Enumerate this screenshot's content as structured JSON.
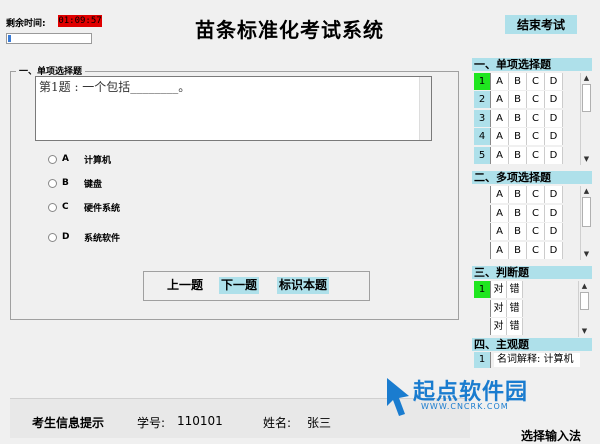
{
  "header": {
    "timer_label": "剩余时间:",
    "timer_value": "01:09:57",
    "progress": 0.03,
    "title": "苗条标准化考试系统",
    "end_button": "结束考试"
  },
  "main": {
    "group_title": "一、单项选择题",
    "question": "第1题 :  一个包括________。",
    "options": [
      {
        "letter": "A",
        "text": "计算机"
      },
      {
        "letter": "B",
        "text": "键盘"
      },
      {
        "letter": "C",
        "text": "硬件系统"
      },
      {
        "letter": "D",
        "text": "系统软件"
      }
    ],
    "nav": {
      "prev": "上一题",
      "next": "下一题",
      "mark": "标识本题"
    }
  },
  "footer": {
    "label": "考生信息提示",
    "id_label": "学号:",
    "id_value": "110101",
    "name_label": "姓名:",
    "name_value": "张三"
  },
  "right_panel": {
    "single": {
      "title": "一、单项选择题",
      "numbers": [
        "1",
        "2",
        "3",
        "4",
        "5"
      ],
      "choices": [
        "A",
        "B",
        "C",
        "D"
      ],
      "current": "1"
    },
    "multi": {
      "title": "二、多项选择题",
      "choices": [
        "A",
        "B",
        "C",
        "D"
      ]
    },
    "judge": {
      "title": "三、判断题",
      "numbers": [
        "1",
        "",
        ""
      ],
      "choices": [
        "对",
        "错"
      ],
      "current": "1"
    },
    "subjective": {
      "title": "四、主观题",
      "number": "1",
      "text": "名词解释: 计算机"
    }
  },
  "input_method": "选择输入法",
  "watermark": {
    "text": "起点软件园",
    "url": "WWW.CNCRK.COM"
  }
}
